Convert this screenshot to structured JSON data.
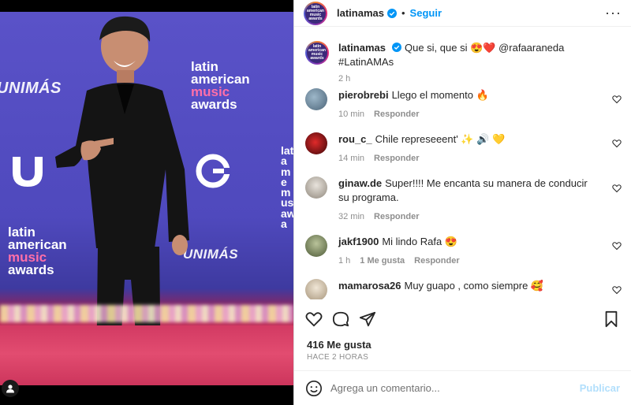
{
  "post": {
    "username": "latinamas",
    "follow_label": "Seguir",
    "more_label": "···",
    "avatar_text": "latin american music awards",
    "caption": {
      "username": "latinamas",
      "text": "Que si, que si 😍❤️ @rafaaraneda #LatinAMAs",
      "time": "2 h"
    }
  },
  "photo": {
    "wall_latin_1": "latin",
    "wall_american_1": "american",
    "wall_music_1": "music",
    "wall_awards_1": "awards",
    "wall_latin_2": "latin",
    "wall_american_2": "american",
    "wall_music_2": "music",
    "wall_awards_2": "awards",
    "wall_unimas_1": "UNIMÁS",
    "wall_unimas_2": "UNIMÁS",
    "wall_side_text": "lat ame mus awa"
  },
  "comments": [
    {
      "user": "pierobrebi",
      "text": "Llego el momento 🔥",
      "time": "10 min",
      "likes": "",
      "reply": "Responder",
      "avatar_color": "#6b8aa8"
    },
    {
      "user": "rou_c_",
      "text": "Chile represeeent' ✨ 🔊 💛",
      "time": "14 min",
      "likes": "",
      "reply": "Responder",
      "avatar_color": "#b3141b"
    },
    {
      "user": "ginaw.de",
      "text": "Super!!!! Me encanta su manera de conducir su programa.",
      "time": "32 min",
      "likes": "",
      "reply": "Responder",
      "avatar_color": "#c9c4bd"
    },
    {
      "user": "jakf1900",
      "text": "Mi lindo Rafa 😍",
      "time": "1 h",
      "likes": "1 Me gusta",
      "reply": "Responder",
      "avatar_color": "#7c8a5c"
    },
    {
      "user": "mamarosa26",
      "text": "Muy guapo , como siempre 🥰",
      "time": "",
      "likes": "",
      "reply": "",
      "avatar_color": "#d9cfc0"
    }
  ],
  "stats": {
    "likes": "416 Me gusta",
    "time_ago": "HACE 2 HORAS"
  },
  "add_comment": {
    "placeholder": "Agrega un comentario...",
    "publish_label": "Publicar"
  },
  "colors": {
    "accent": "#0095f6",
    "publish_disabled": "#b2dffc",
    "muted": "#8e8e8e",
    "text": "#262626"
  }
}
